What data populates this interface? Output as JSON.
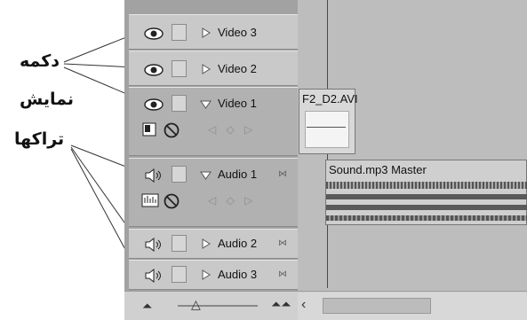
{
  "callout": {
    "line1": "دکمه",
    "line2": "نمایش",
    "line3": "تراکها"
  },
  "tracks": [
    {
      "name": "Video 3",
      "type": "video",
      "expanded": false
    },
    {
      "name": "Video 2",
      "type": "video",
      "expanded": false
    },
    {
      "name": "Video 1",
      "type": "video",
      "expanded": true
    },
    {
      "name": "Audio 1",
      "type": "audio",
      "expanded": true
    },
    {
      "name": "Audio 2",
      "type": "audio",
      "expanded": false
    },
    {
      "name": "Audio 3",
      "type": "audio",
      "expanded": false
    }
  ],
  "clips": {
    "video": "F2_D2.AVI",
    "audio": "Sound.mp3 Master"
  },
  "icons": {
    "visibility": "eye-icon",
    "speaker": "speaker-icon",
    "lock": "lock-box-icon",
    "collapse": "triangle-right-icon",
    "expand": "triangle-down-icon",
    "no": "prohibited-icon",
    "zoom_out": "zoom-out-icon",
    "zoom_in": "zoom-in-icon",
    "scroll_left": "scroll-left-icon"
  },
  "colors": {
    "panel": "#a2a2a2",
    "header": "#c9c9c9",
    "audio_wave": "#5a5a5a",
    "clip": "#d8d8d8"
  }
}
